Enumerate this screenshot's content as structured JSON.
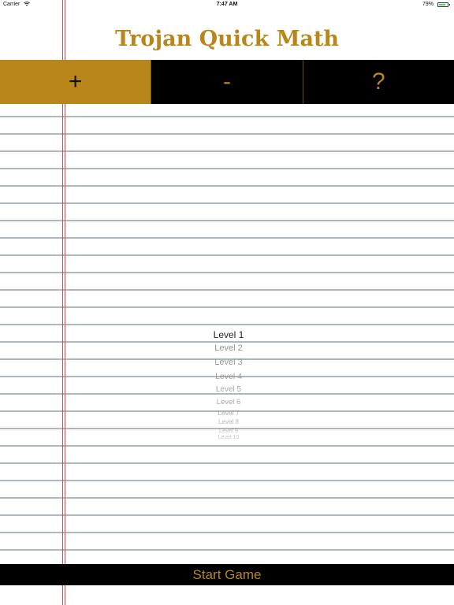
{
  "status_bar": {
    "carrier": "Carrier",
    "time": "7:47 AM",
    "battery": "79%",
    "battery_level": 0.79,
    "wifi_icon": "wifi-icon",
    "battery_icon": "battery-icon"
  },
  "title": "Trojan Quick Math",
  "colors": {
    "accent": "#b8861b",
    "bar": "#000000",
    "margin_line": "#d64a4a",
    "ruled_line": "#aeb7bb"
  },
  "operations": [
    {
      "label": "+",
      "selected": true
    },
    {
      "label": "-",
      "selected": false
    },
    {
      "label": "?",
      "selected": false
    }
  ],
  "levels": {
    "selected": "Level 1",
    "items": [
      "Level 1",
      "Level 2",
      "Level 3",
      "Level 4",
      "Level 5",
      "Level 6",
      "Level 7",
      "Level 8",
      "Level 9",
      "Level 10"
    ]
  },
  "start_game_label": "Start Game"
}
